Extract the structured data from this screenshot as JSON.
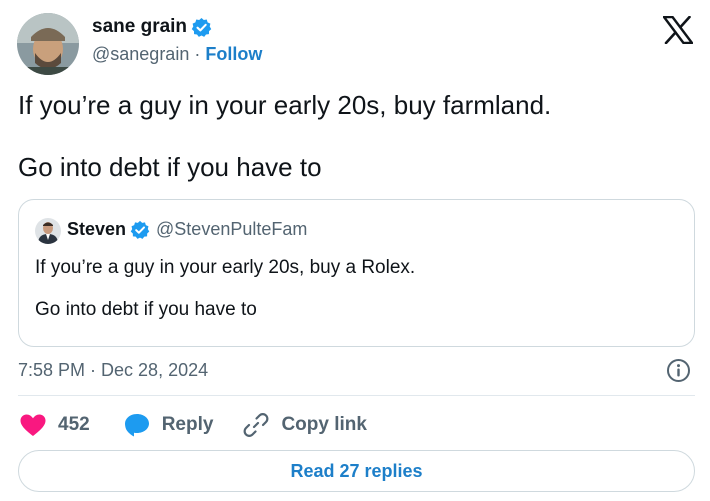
{
  "author": {
    "name": "sane grain",
    "handle": "@sanegrain",
    "separator": " · ",
    "follow_label": "Follow"
  },
  "tweet": {
    "lines": [
      "If you’re a guy in your early 20s, buy farmland.",
      "Go into debt if you have to"
    ]
  },
  "quoted_tweet": {
    "name": "Steven",
    "handle": "@StevenPulteFam",
    "lines": [
      "If you’re a guy in your early 20s, buy a Rolex.",
      "Go into debt if you have to"
    ]
  },
  "timestamp": "7:58 PM · Dec 28, 2024",
  "actions": {
    "like_count": "452",
    "reply_label": "Reply",
    "copy_label": "Copy link"
  },
  "read_replies_label": "Read 27 replies",
  "colors": {
    "brand_blue": "#1d7fc9",
    "verified_blue": "#1d9bf0",
    "like_red": "#f91880",
    "secondary_text": "#536471",
    "border": "#cfd9de"
  },
  "icons": {
    "logo": "x-logo-icon",
    "verified": "verified-badge-icon",
    "info": "info-icon",
    "like": "heart-icon",
    "reply": "reply-bubble-icon",
    "copy": "link-icon"
  }
}
